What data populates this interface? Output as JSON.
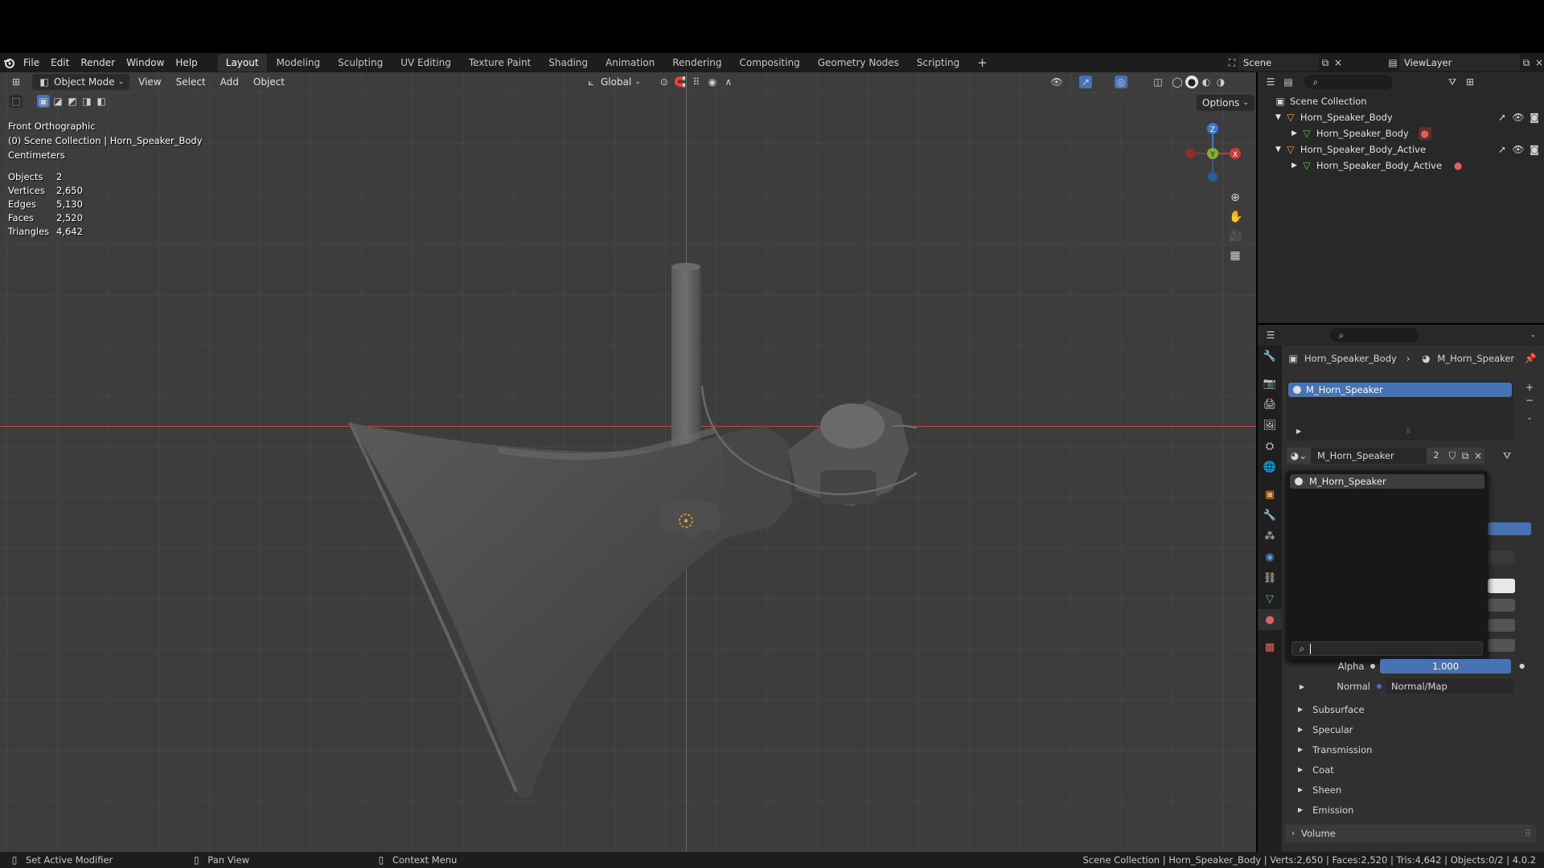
{
  "topbar": {
    "menus": [
      "File",
      "Edit",
      "Render",
      "Window",
      "Help"
    ],
    "workspaces": [
      "Layout",
      "Modeling",
      "Sculpting",
      "UV Editing",
      "Texture Paint",
      "Shading",
      "Animation",
      "Rendering",
      "Compositing",
      "Geometry Nodes",
      "Scripting"
    ],
    "active_workspace": "Layout",
    "scene_name": "Scene",
    "view_layer": "ViewLayer"
  },
  "viewport": {
    "mode": "Object Mode",
    "menus": [
      "View",
      "Select",
      "Add",
      "Object"
    ],
    "transform_orientation": "Global",
    "options_label": "Options",
    "view_name": "Front Orthographic",
    "collection_info": "(0) Scene Collection | Horn_Speaker_Body",
    "units": "Centimeters",
    "stats": [
      {
        "label": "Objects",
        "value": "2"
      },
      {
        "label": "Vertices",
        "value": "2,650"
      },
      {
        "label": "Edges",
        "value": "5,130"
      },
      {
        "label": "Faces",
        "value": "2,520"
      },
      {
        "label": "Triangles",
        "value": "4,642"
      }
    ],
    "gizmo_axes": {
      "z": "Z",
      "y": "Y",
      "x": "X"
    }
  },
  "outliner": {
    "root": "Scene Collection",
    "items": [
      {
        "name": "Horn_Speaker_Body",
        "level": 1
      },
      {
        "name": "Horn_Speaker_Body",
        "level": 2
      },
      {
        "name": "Horn_Speaker_Body_Active",
        "level": 1
      },
      {
        "name": "Horn_Speaker_Body_Active",
        "level": 2
      }
    ]
  },
  "properties": {
    "breadcrumb_object": "Horn_Speaker_Body",
    "breadcrumb_material": "M_Horn_Speaker",
    "slot_name": "M_Horn_Speaker",
    "material_name": "M_Horn_Speaker",
    "user_count": "2",
    "dropdown_item": "M_Horn_Speaker",
    "alpha_label": "Alpha",
    "alpha_value": "1.000",
    "alpha_fraction": 1.0,
    "normal_label": "Normal",
    "normal_value": "Normal/Map",
    "sections": [
      "Subsurface",
      "Specular",
      "Transmission",
      "Coat",
      "Sheen",
      "Emission"
    ],
    "volume_label": "Volume"
  },
  "statusbar": {
    "left1": "Set Active Modifier",
    "left2": "Pan View",
    "left3": "Context Menu",
    "right": "Scene Collection | Horn_Speaker_Body | Verts:2,650 | Faces:2,520 | Tris:4,642 | Objects:0/2 | 4.0.2"
  },
  "colors": {
    "accent": "#4772b3",
    "x_axis": "#c73b3b",
    "y_axis": "#7cb431",
    "z_axis": "#3b7ac7"
  }
}
